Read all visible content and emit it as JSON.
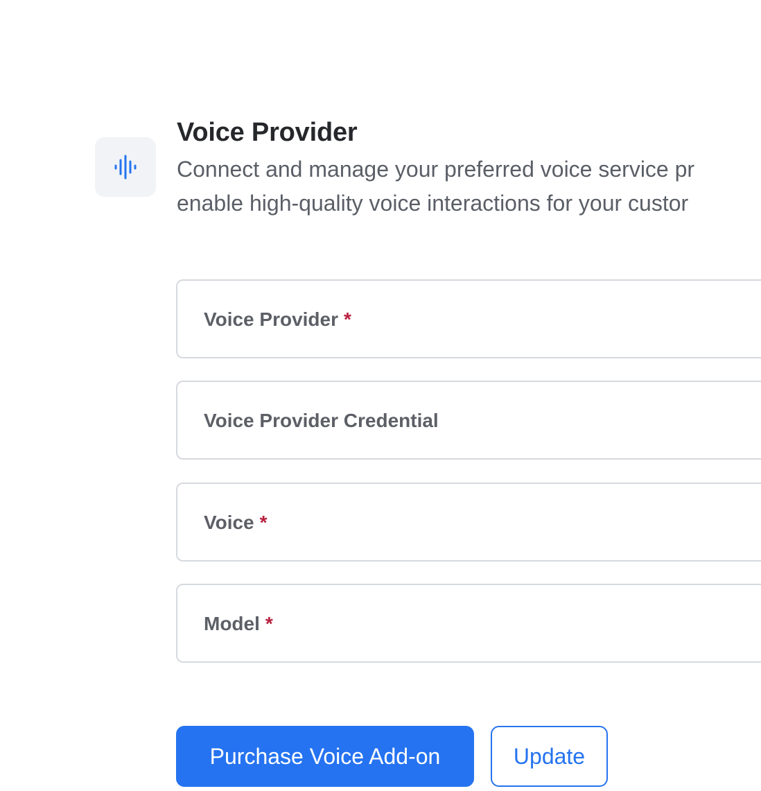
{
  "section": {
    "title": "Voice Provider",
    "description_line1": "Connect and manage your preferred voice service pr",
    "description_line2": "enable high-quality voice interactions for your custor",
    "icon": "audio-waveform-icon"
  },
  "form": {
    "fields": [
      {
        "label": "Voice Provider",
        "required_mark": "*"
      },
      {
        "label": "Voice Provider Credential",
        "required_mark": ""
      },
      {
        "label": "Voice",
        "required_mark": "*"
      },
      {
        "label": "Model",
        "required_mark": "*"
      }
    ]
  },
  "actions": {
    "purchase_label": "Purchase Voice Add-on",
    "update_label": "Update"
  },
  "colors": {
    "accent": "#2573f0",
    "required": "#b8213f",
    "border": "#d6d9de",
    "icon_tile_bg": "#f1f3f6"
  }
}
